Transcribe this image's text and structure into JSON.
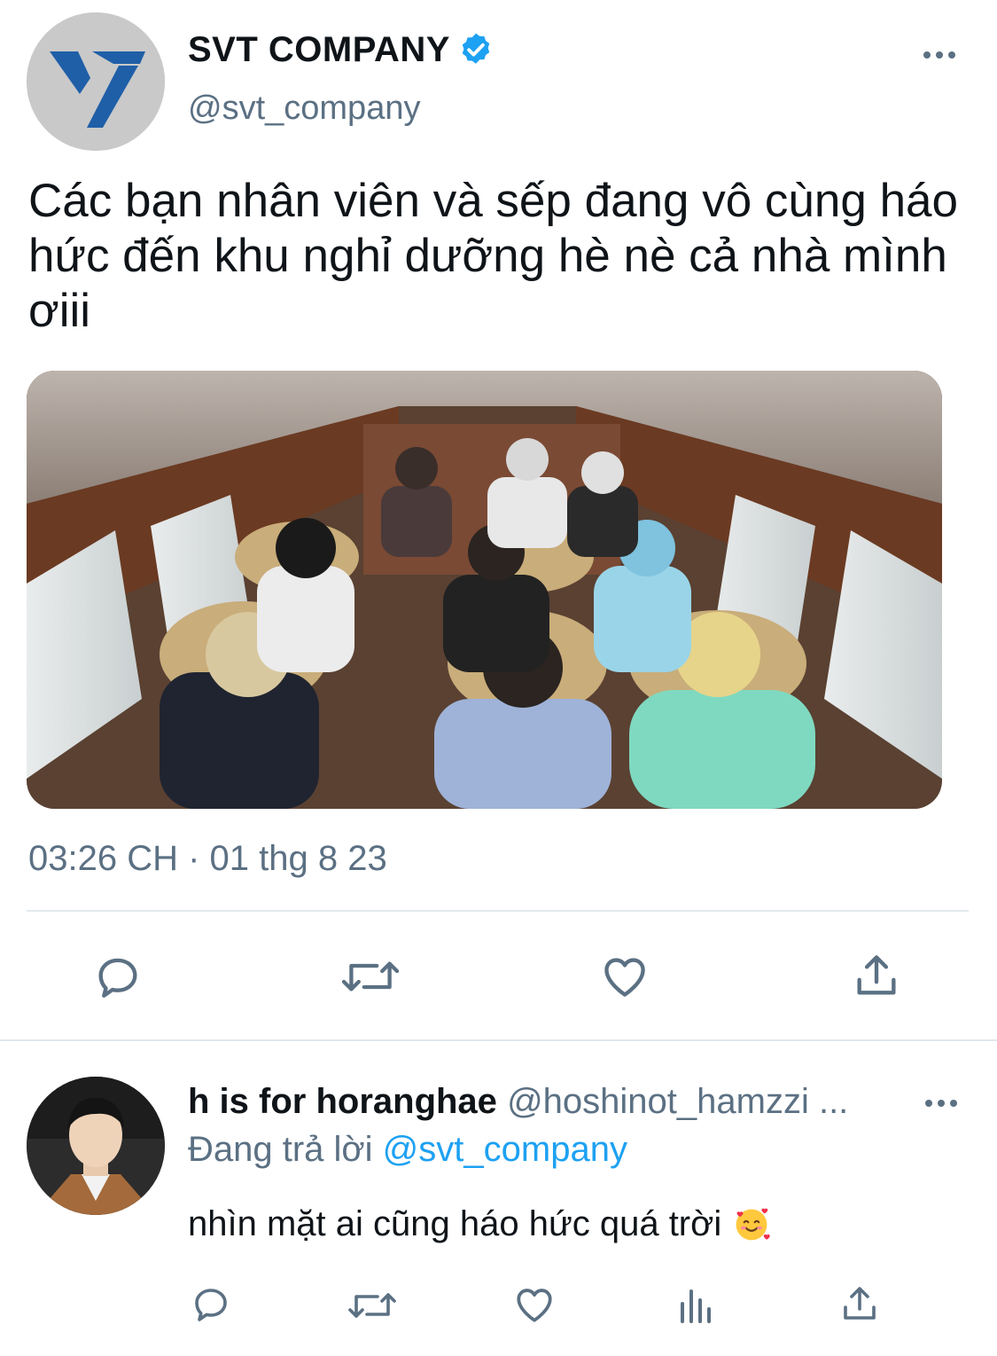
{
  "tweet": {
    "author": {
      "display_name": "SVT COMPANY",
      "handle": "@svt_company",
      "verified": true,
      "avatar_icon": "seventeen-logo-icon"
    },
    "text": "Các bạn nhân viên và sếp đang vô cùng háo hức đến khu nghỉ dưỡng hè nè cả nhà mình ơiii",
    "media_alt": "photo-bus-interior",
    "timestamp": "03:26 CH · 01 thg 8 23",
    "actions": [
      "reply-icon",
      "retweet-icon",
      "like-icon",
      "share-icon"
    ]
  },
  "reply": {
    "author": {
      "display_name": "h is for horanghae",
      "handle": "@hoshinot_hamzzi ..."
    },
    "replying_prefix": "Đang trả lời",
    "replying_handle": "@svt_company",
    "text": "nhìn mặt ai cũng háo hức quá trời",
    "emoji": "smiling-face-with-hearts-icon",
    "actions": [
      "reply-icon",
      "retweet-icon",
      "like-icon",
      "stats-icon",
      "share-icon"
    ]
  },
  "colors": {
    "text_primary": "#0f1419",
    "text_secondary": "#5b7083",
    "accent_blue": "#1da1f2",
    "divider": "#e1e8ed",
    "logo_blue": "#1f5fa8"
  }
}
